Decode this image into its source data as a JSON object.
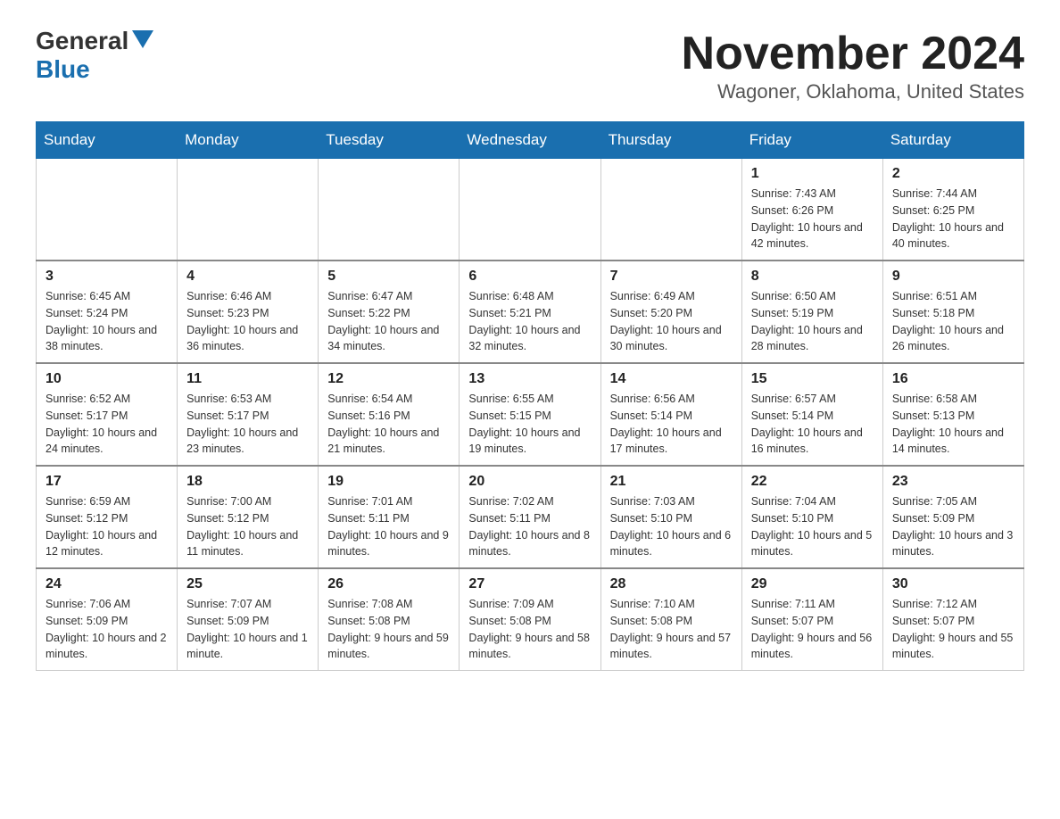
{
  "header": {
    "logo_general": "General",
    "logo_blue": "Blue",
    "month_title": "November 2024",
    "location": "Wagoner, Oklahoma, United States"
  },
  "days_of_week": [
    "Sunday",
    "Monday",
    "Tuesday",
    "Wednesday",
    "Thursday",
    "Friday",
    "Saturday"
  ],
  "weeks": [
    [
      {
        "day": "",
        "info": ""
      },
      {
        "day": "",
        "info": ""
      },
      {
        "day": "",
        "info": ""
      },
      {
        "day": "",
        "info": ""
      },
      {
        "day": "",
        "info": ""
      },
      {
        "day": "1",
        "info": "Sunrise: 7:43 AM\nSunset: 6:26 PM\nDaylight: 10 hours and 42 minutes."
      },
      {
        "day": "2",
        "info": "Sunrise: 7:44 AM\nSunset: 6:25 PM\nDaylight: 10 hours and 40 minutes."
      }
    ],
    [
      {
        "day": "3",
        "info": "Sunrise: 6:45 AM\nSunset: 5:24 PM\nDaylight: 10 hours and 38 minutes."
      },
      {
        "day": "4",
        "info": "Sunrise: 6:46 AM\nSunset: 5:23 PM\nDaylight: 10 hours and 36 minutes."
      },
      {
        "day": "5",
        "info": "Sunrise: 6:47 AM\nSunset: 5:22 PM\nDaylight: 10 hours and 34 minutes."
      },
      {
        "day": "6",
        "info": "Sunrise: 6:48 AM\nSunset: 5:21 PM\nDaylight: 10 hours and 32 minutes."
      },
      {
        "day": "7",
        "info": "Sunrise: 6:49 AM\nSunset: 5:20 PM\nDaylight: 10 hours and 30 minutes."
      },
      {
        "day": "8",
        "info": "Sunrise: 6:50 AM\nSunset: 5:19 PM\nDaylight: 10 hours and 28 minutes."
      },
      {
        "day": "9",
        "info": "Sunrise: 6:51 AM\nSunset: 5:18 PM\nDaylight: 10 hours and 26 minutes."
      }
    ],
    [
      {
        "day": "10",
        "info": "Sunrise: 6:52 AM\nSunset: 5:17 PM\nDaylight: 10 hours and 24 minutes."
      },
      {
        "day": "11",
        "info": "Sunrise: 6:53 AM\nSunset: 5:17 PM\nDaylight: 10 hours and 23 minutes."
      },
      {
        "day": "12",
        "info": "Sunrise: 6:54 AM\nSunset: 5:16 PM\nDaylight: 10 hours and 21 minutes."
      },
      {
        "day": "13",
        "info": "Sunrise: 6:55 AM\nSunset: 5:15 PM\nDaylight: 10 hours and 19 minutes."
      },
      {
        "day": "14",
        "info": "Sunrise: 6:56 AM\nSunset: 5:14 PM\nDaylight: 10 hours and 17 minutes."
      },
      {
        "day": "15",
        "info": "Sunrise: 6:57 AM\nSunset: 5:14 PM\nDaylight: 10 hours and 16 minutes."
      },
      {
        "day": "16",
        "info": "Sunrise: 6:58 AM\nSunset: 5:13 PM\nDaylight: 10 hours and 14 minutes."
      }
    ],
    [
      {
        "day": "17",
        "info": "Sunrise: 6:59 AM\nSunset: 5:12 PM\nDaylight: 10 hours and 12 minutes."
      },
      {
        "day": "18",
        "info": "Sunrise: 7:00 AM\nSunset: 5:12 PM\nDaylight: 10 hours and 11 minutes."
      },
      {
        "day": "19",
        "info": "Sunrise: 7:01 AM\nSunset: 5:11 PM\nDaylight: 10 hours and 9 minutes."
      },
      {
        "day": "20",
        "info": "Sunrise: 7:02 AM\nSunset: 5:11 PM\nDaylight: 10 hours and 8 minutes."
      },
      {
        "day": "21",
        "info": "Sunrise: 7:03 AM\nSunset: 5:10 PM\nDaylight: 10 hours and 6 minutes."
      },
      {
        "day": "22",
        "info": "Sunrise: 7:04 AM\nSunset: 5:10 PM\nDaylight: 10 hours and 5 minutes."
      },
      {
        "day": "23",
        "info": "Sunrise: 7:05 AM\nSunset: 5:09 PM\nDaylight: 10 hours and 3 minutes."
      }
    ],
    [
      {
        "day": "24",
        "info": "Sunrise: 7:06 AM\nSunset: 5:09 PM\nDaylight: 10 hours and 2 minutes."
      },
      {
        "day": "25",
        "info": "Sunrise: 7:07 AM\nSunset: 5:09 PM\nDaylight: 10 hours and 1 minute."
      },
      {
        "day": "26",
        "info": "Sunrise: 7:08 AM\nSunset: 5:08 PM\nDaylight: 9 hours and 59 minutes."
      },
      {
        "day": "27",
        "info": "Sunrise: 7:09 AM\nSunset: 5:08 PM\nDaylight: 9 hours and 58 minutes."
      },
      {
        "day": "28",
        "info": "Sunrise: 7:10 AM\nSunset: 5:08 PM\nDaylight: 9 hours and 57 minutes."
      },
      {
        "day": "29",
        "info": "Sunrise: 7:11 AM\nSunset: 5:07 PM\nDaylight: 9 hours and 56 minutes."
      },
      {
        "day": "30",
        "info": "Sunrise: 7:12 AM\nSunset: 5:07 PM\nDaylight: 9 hours and 55 minutes."
      }
    ]
  ]
}
